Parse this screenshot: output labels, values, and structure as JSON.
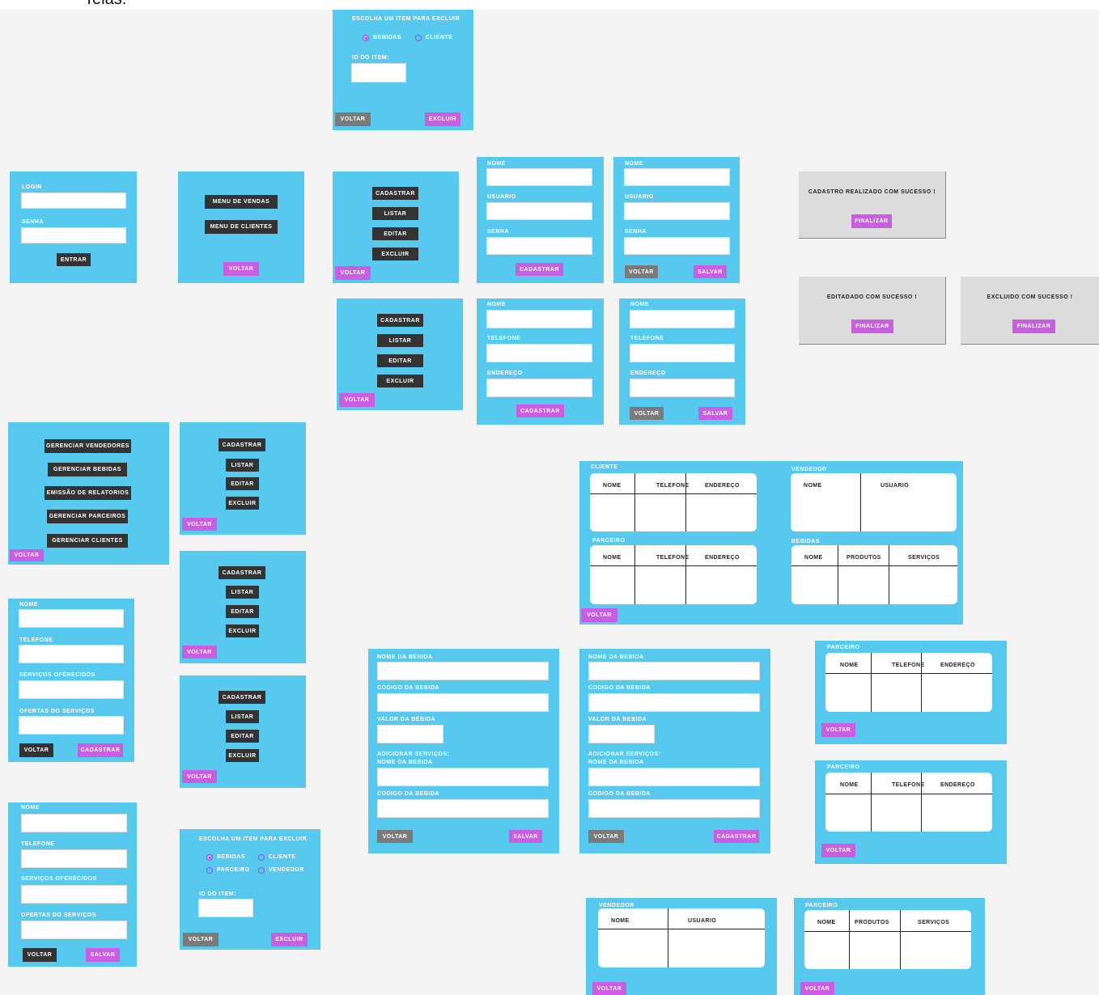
{
  "top_text": "Telas:",
  "labels": {
    "login": "LOGIN",
    "senha": "SENHA",
    "nome": "NOME",
    "usuario": "USUARIO",
    "telefone": "TELEFONE",
    "endereco": "ENDEREÇO",
    "servicos_oferecidos": "SERVIÇOS OFERECIDOS",
    "ofertas_servicos": "OFERTAS DO SERVIÇOS",
    "nome_bebida": "NOME DA BEBIDA",
    "codigo_bebida": "CODIGO DA BEBIDA",
    "valor_bebida": "VALOR DA BEBIDA",
    "adicionar_servicos": "ADICIONAR SERVIÇOS:",
    "id_item": "ID DO ITEM:",
    "escolha_item": "ESCOLHA UM ITEM PARA EXCLUIR",
    "bebidas": "BEBIDAS",
    "cliente": "CLIENTE",
    "parceiro": "PARCEIRO",
    "vendedor": "VENDEDOR"
  },
  "buttons": {
    "entrar": "ENTRAR",
    "voltar": "VOLTAR",
    "excluir": "EXCLUIR",
    "cadastrar": "CADASTRAR",
    "listar": "LISTAR",
    "editar": "EDITAR",
    "salvar": "SALVAR",
    "finalizar": "FINALIZAR",
    "menu_vendas": "MENU DE VENDAS",
    "menu_clientes": "MENU DE CLIENTES",
    "ger_vendedores": "GERENCIAR VENDEDORES",
    "ger_bebidas": "GERENCIAR BEBIDAS",
    "emissao_relatorios": "EMISSÃO DE RELATORIOS",
    "ger_parceiros": "GERENCIAR PARCEIROS",
    "ger_clientes": "GERENCIAR CLIENTES"
  },
  "messages": {
    "cadastro_sucesso": "CADASTRO REALIZADO COM SUCESSO !",
    "editado_sucesso": "EDITADADO COM SUCESSO !",
    "excluido_sucesso": "EXCLUIDO COM SUCESSO !"
  },
  "report_sections": {
    "cliente": "CLIENTE",
    "vendedor": "VENDEDOR",
    "parceiro": "PARCEIRO",
    "bebidas": "BEBIDAS"
  },
  "table_headers": {
    "nome": "NOME",
    "telefone": "TELEFONE",
    "endereco": "ENDEREÇO",
    "usuario": "USUARIO",
    "produtos": "PRODUTOS",
    "servicos": "SERVIÇOS"
  }
}
